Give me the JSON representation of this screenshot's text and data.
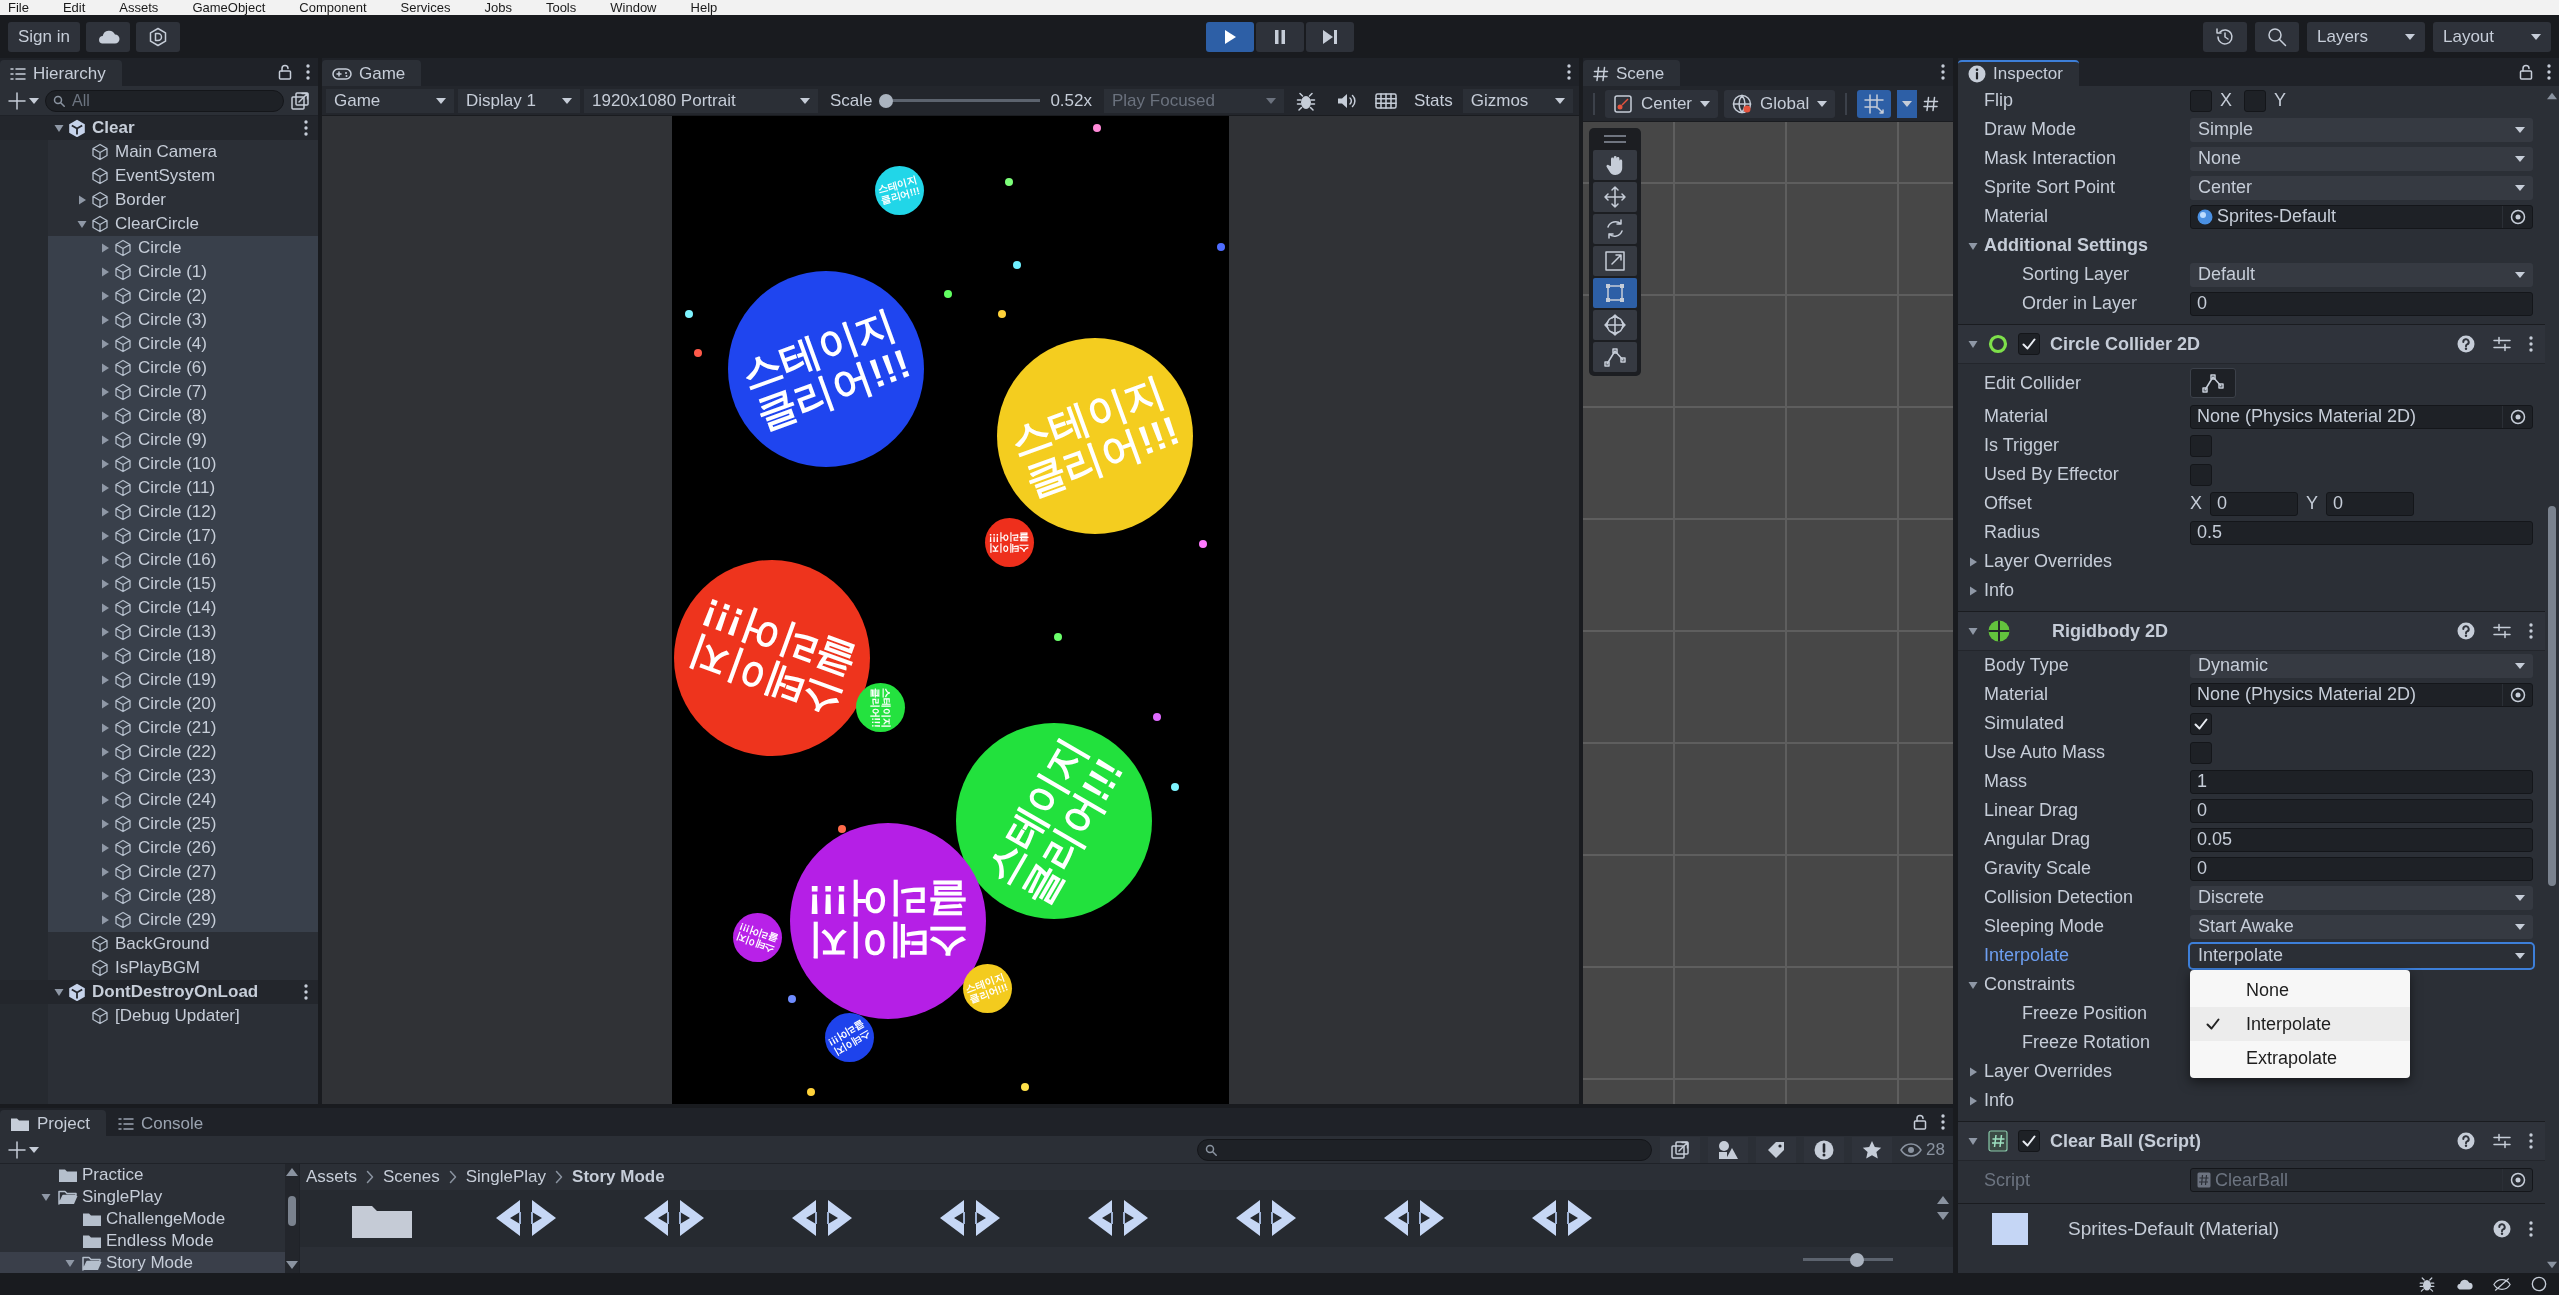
{
  "menu_bar": [
    "File",
    "Edit",
    "Assets",
    "GameObject",
    "Component",
    "Services",
    "Jobs",
    "Tools",
    "Window",
    "Help"
  ],
  "toolbar": {
    "sign_in": "Sign in",
    "playback": [
      {
        "kind": "play",
        "on": true
      },
      {
        "kind": "pause",
        "on": false
      },
      {
        "kind": "step",
        "on": false
      }
    ],
    "layers": "Layers",
    "layout": "Layout"
  },
  "hierarchy": {
    "title": "Hierarchy",
    "search": {
      "placeholder": "All"
    },
    "tree": [
      {
        "kind": "scene",
        "name": "Clear",
        "expanded": true,
        "selected": false,
        "children": [
          {
            "kind": "object",
            "name": "Main Camera",
            "selected": false
          },
          {
            "kind": "object",
            "name": "EventSystem",
            "selected": false
          },
          {
            "kind": "object",
            "name": "Border",
            "expanded": false,
            "selected": false
          },
          {
            "kind": "object",
            "name": "ClearCircle",
            "expanded": true,
            "selected": false,
            "children": [
              {
                "kind": "object",
                "name": "Circle",
                "expanded": false,
                "selected": true
              },
              {
                "kind": "object",
                "name": "Circle (1)",
                "expanded": false,
                "selected": true
              },
              {
                "kind": "object",
                "name": "Circle (2)",
                "expanded": false,
                "selected": true
              },
              {
                "kind": "object",
                "name": "Circle (3)",
                "expanded": false,
                "selected": true
              },
              {
                "kind": "object",
                "name": "Circle (4)",
                "expanded": false,
                "selected": true
              },
              {
                "kind": "object",
                "name": "Circle (6)",
                "expanded": false,
                "selected": true
              },
              {
                "kind": "object",
                "name": "Circle (7)",
                "expanded": false,
                "selected": true
              },
              {
                "kind": "object",
                "name": "Circle (8)",
                "expanded": false,
                "selected": true
              },
              {
                "kind": "object",
                "name": "Circle (9)",
                "expanded": false,
                "selected": true
              },
              {
                "kind": "object",
                "name": "Circle (10)",
                "expanded": false,
                "selected": true
              },
              {
                "kind": "object",
                "name": "Circle (11)",
                "expanded": false,
                "selected": true
              },
              {
                "kind": "object",
                "name": "Circle (12)",
                "expanded": false,
                "selected": true
              },
              {
                "kind": "object",
                "name": "Circle (17)",
                "expanded": false,
                "selected": true
              },
              {
                "kind": "object",
                "name": "Circle (16)",
                "expanded": false,
                "selected": true
              },
              {
                "kind": "object",
                "name": "Circle (15)",
                "expanded": false,
                "selected": true
              },
              {
                "kind": "object",
                "name": "Circle (14)",
                "expanded": false,
                "selected": true
              },
              {
                "kind": "object",
                "name": "Circle (13)",
                "expanded": false,
                "selected": true
              },
              {
                "kind": "object",
                "name": "Circle (18)",
                "expanded": false,
                "selected": true
              },
              {
                "kind": "object",
                "name": "Circle (19)",
                "expanded": false,
                "selected": true
              },
              {
                "kind": "object",
                "name": "Circle (20)",
                "expanded": false,
                "selected": true
              },
              {
                "kind": "object",
                "name": "Circle (21)",
                "expanded": false,
                "selected": true
              },
              {
                "kind": "object",
                "name": "Circle (22)",
                "expanded": false,
                "selected": true
              },
              {
                "kind": "object",
                "name": "Circle (23)",
                "expanded": false,
                "selected": true
              },
              {
                "kind": "object",
                "name": "Circle (24)",
                "expanded": false,
                "selected": true
              },
              {
                "kind": "object",
                "name": "Circle (25)",
                "expanded": false,
                "selected": true
              },
              {
                "kind": "object",
                "name": "Circle (26)",
                "expanded": false,
                "selected": true
              },
              {
                "kind": "object",
                "name": "Circle (27)",
                "expanded": false,
                "selected": true
              },
              {
                "kind": "object",
                "name": "Circle (28)",
                "expanded": false,
                "selected": true
              },
              {
                "kind": "object",
                "name": "Circle (29)",
                "expanded": false,
                "selected": true
              }
            ]
          },
          {
            "kind": "object",
            "name": "BackGround",
            "selected": false
          },
          {
            "kind": "object",
            "name": "IsPlayBGM",
            "selected": false
          }
        ]
      },
      {
        "kind": "scene",
        "name": "DontDestroyOnLoad",
        "expanded": true,
        "selected": false,
        "children": [
          {
            "kind": "object",
            "name": "[Debug Updater]",
            "selected": false
          }
        ]
      }
    ]
  },
  "game": {
    "title": "Game",
    "toolbar": {
      "view": "Game",
      "display": "Display 1",
      "resolution": "1920x1080 Portrait",
      "scale": {
        "label": "Scale",
        "level": 0.02,
        "reading": "0.52x"
      },
      "play_mode": {
        "label": "Play Focused",
        "disabled": true
      },
      "stats": "Stats",
      "gizmos": "Gizmos"
    },
    "circles": [
      {
        "lines": [
          "스테이지",
          "클리어!!!"
        ],
        "color": "#21d6e8"
      },
      {
        "lines": [
          "스테이지",
          "클리어!!!"
        ],
        "color": "#1f45ef"
      },
      {
        "lines": [
          "스테이지",
          "클리어!!!"
        ],
        "color": "#f4cd1f"
      },
      {
        "lines": [
          "스테이지",
          "클리어!!!"
        ],
        "color": "#ee2f1c"
      },
      {
        "lines": [
          "스테이지",
          "클리어!!!"
        ],
        "color": "#ee341d"
      },
      {
        "lines": [
          "스테이지",
          "클리어!!!"
        ],
        "color": "#24e23f"
      },
      {
        "lines": [
          "스테이지",
          "클리어!!!"
        ],
        "color": "#22e13d"
      },
      {
        "lines": [
          "스테이지",
          "클리어!!!"
        ],
        "color": "#b51fe6"
      },
      {
        "lines": [
          "스테이지",
          "클리어!!!"
        ],
        "color": "#b821e8"
      },
      {
        "lines": [
          "스테이지",
          "클리어!!!"
        ],
        "color": "#f3cb1e"
      },
      {
        "lines": [
          "스테이지",
          "클리어!!!"
        ],
        "color": "#1e43ec"
      }
    ]
  },
  "scene": {
    "title": "Scene",
    "pivot": "Center",
    "space": "Global",
    "grid_snap": {
      "on": true
    },
    "tools": [
      {
        "kind": "hand",
        "selected": false
      },
      {
        "kind": "move",
        "selected": false
      },
      {
        "kind": "rotate",
        "selected": false
      },
      {
        "kind": "scale",
        "selected": false
      },
      {
        "kind": "rect",
        "selected": true
      },
      {
        "kind": "transform",
        "selected": false
      },
      {
        "kind": "custom",
        "selected": false
      }
    ]
  },
  "inspector": {
    "title": "Inspector",
    "focused": true,
    "rows": [
      {
        "kind": "toggles",
        "label": "Flip",
        "toggles": [
          {
            "label": "X",
            "checked": false
          },
          {
            "label": "Y",
            "checked": false
          }
        ]
      },
      {
        "kind": "dropdown",
        "label": "Draw Mode",
        "value": "Simple",
        "focused": false
      },
      {
        "kind": "dropdown",
        "label": "Mask Interaction",
        "value": "None",
        "focused": false
      },
      {
        "kind": "dropdown",
        "label": "Sprite Sort Point",
        "value": "Center",
        "focused": false
      },
      {
        "kind": "material_object",
        "label": "Material",
        "value": "Sprites-Default",
        "disabled": false
      },
      {
        "kind": "group",
        "label": "Additional Settings",
        "expanded": true,
        "children": [
          {
            "kind": "dropdown",
            "label": "Sorting Layer",
            "value": "Default",
            "focused": false
          },
          {
            "kind": "number",
            "label": "Order in Layer",
            "value": "0"
          }
        ]
      },
      {
        "kind": "collider",
        "title": "Circle Collider 2D",
        "expanded": true,
        "enabled": true
      },
      {
        "kind": "edit_button",
        "label": "Edit Collider"
      },
      {
        "kind": "object",
        "label": "Material",
        "value": "None (Physics Material 2D)",
        "disabled": false
      },
      {
        "kind": "checkbox",
        "label": "Is Trigger",
        "checked": false
      },
      {
        "kind": "checkbox",
        "label": "Used By Effector",
        "checked": false
      },
      {
        "kind": "vector2",
        "label": "Offset",
        "fields": [
          {
            "label": "X",
            "value": "0"
          },
          {
            "label": "Y",
            "value": "0"
          }
        ]
      },
      {
        "kind": "number",
        "label": "Radius",
        "value": "0.5"
      },
      {
        "kind": "foldout",
        "label": "Layer Overrides",
        "expanded": false
      },
      {
        "kind": "foldout",
        "label": "Info",
        "expanded": false
      },
      {
        "kind": "rigidbody",
        "title": "Rigidbody 2D",
        "expanded": true
      },
      {
        "kind": "dropdown",
        "label": "Body Type",
        "value": "Dynamic",
        "focused": false
      },
      {
        "kind": "object",
        "label": "Material",
        "value": "None (Physics Material 2D)",
        "disabled": false
      },
      {
        "kind": "checkbox",
        "label": "Simulated",
        "checked": true
      },
      {
        "kind": "checkbox",
        "label": "Use Auto Mass",
        "checked": false
      },
      {
        "kind": "number",
        "label": "Mass",
        "value": "1"
      },
      {
        "kind": "number",
        "label": "Linear Drag",
        "value": "0"
      },
      {
        "kind": "number",
        "label": "Angular Drag",
        "value": "0.05"
      },
      {
        "kind": "number",
        "label": "Gravity Scale",
        "value": "0"
      },
      {
        "kind": "dropdown",
        "label": "Collision Detection",
        "value": "Discrete",
        "focused": false
      },
      {
        "kind": "dropdown",
        "label": "Sleeping Mode",
        "value": "Start Awake",
        "focused": false
      },
      {
        "kind": "dropdown",
        "label": "Interpolate",
        "value": "Interpolate",
        "focused": true,
        "menu": [
          {
            "label": "None",
            "selected": false
          },
          {
            "label": "Interpolate",
            "selected": true
          },
          {
            "label": "Extrapolate",
            "selected": false
          }
        ]
      },
      {
        "kind": "foldout",
        "label": "Constraints",
        "expanded": true,
        "children": [
          {
            "kind": "label",
            "label": "Freeze Position"
          },
          {
            "kind": "label",
            "label": "Freeze Rotation"
          }
        ]
      },
      {
        "kind": "foldout",
        "label": "Layer Overrides",
        "expanded": false
      },
      {
        "kind": "foldout",
        "label": "Info",
        "expanded": false
      },
      {
        "kind": "script",
        "title": "Clear Ball (Script)",
        "expanded": true,
        "enabled": true
      },
      {
        "kind": "script_object",
        "label": "Script",
        "value": "ClearBall",
        "disabled": true
      },
      {
        "kind": "material",
        "title": "Sprites-Default (Material)"
      }
    ]
  },
  "project": {
    "tabs": [
      {
        "label": "Project",
        "selected": true
      },
      {
        "label": "Console",
        "selected": false
      }
    ],
    "count": "28",
    "folders": [
      {
        "name": "Practice",
        "selected": false
      },
      {
        "name": "SinglePlay",
        "expanded": true,
        "selected": false,
        "children": [
          {
            "name": "ChallengeMode",
            "selected": false
          },
          {
            "name": "Endless Mode",
            "selected": false
          },
          {
            "name": "Story Mode",
            "expanded": true,
            "selected": true
          }
        ]
      }
    ],
    "breadcrumb": [
      "Assets",
      "Scenes",
      "SinglePlay",
      "Story Mode"
    ],
    "assets": [
      {
        "kind": "folder"
      },
      {
        "kind": "scene"
      },
      {
        "kind": "scene"
      },
      {
        "kind": "scene"
      },
      {
        "kind": "scene"
      },
      {
        "kind": "scene"
      },
      {
        "kind": "scene"
      },
      {
        "kind": "scene"
      },
      {
        "kind": "scene"
      }
    ],
    "icon_size": {
      "level": 0.6
    }
  }
}
